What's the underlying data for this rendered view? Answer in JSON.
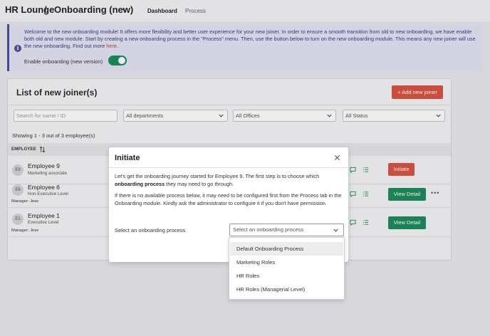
{
  "header": {
    "root": "HR Lounge",
    "separator": "/",
    "current": "Onboarding (new)",
    "tabs": [
      "Dashboard",
      "Process"
    ]
  },
  "banner": {
    "text": "Welcome to the new onboarding module! It offers more flexibility and better user experience for your new joiner. In order to ensure a smooth transition from old to new onboarding, we have enable both old and new module. Start by creating a new onboarding process in the \"Process\" menu. Then, use the button below to turn on the new onboarding module. This means any new joiner will use the new onboarding. Find out more ",
    "link": "here",
    "link_suffix": ".",
    "toggle_label": "Enable onboarding (new version)",
    "toggle_on": true
  },
  "card": {
    "title": "List of new joiner(s)",
    "add_button": "+ Add new joiner",
    "filters": {
      "search_placeholder": "Search for name / ID",
      "department": "All departments",
      "office": "All Offices",
      "status": "All Status"
    },
    "showing": "Showing 1 - 3 out of 3 employee(s)",
    "column_employee": "EMPLOYEE",
    "rows": [
      {
        "initials": "E9",
        "name": "Employee 9",
        "role": "Marketing associate",
        "manager": "",
        "action": "Initiate"
      },
      {
        "initials": "E6",
        "name": "Employee 6",
        "role": "Non-Executive Level",
        "manager": "Manager: Jess",
        "action": "View Detail"
      },
      {
        "initials": "E1",
        "name": "Employee 1",
        "role": "Executive Level",
        "manager": "Manager: Jess",
        "action": "View Detail"
      }
    ],
    "more": "•••"
  },
  "modal": {
    "title": "Initiate",
    "p1_before": "Let's get the onboarding journey started for Employee 9. The first step is to choose which ",
    "p1_bold": "onboarding process",
    "p1_after": " they may need to go through.",
    "p2": "If there is no available process below, it may need to be configured first from the Process tab in the Onboarding module. Kindly ask the administrator to configure it if you don't have permission.",
    "select_label": "Select an onboarding process",
    "select_placeholder": "Select an onboarding process",
    "options": [
      "Default Onboarding Process",
      "Marketing Roles",
      "HR Roles",
      "HR Roles (Managerial Level)"
    ],
    "highlighted_option": 0
  },
  "colors": {
    "primary_red": "#d9533f",
    "primary_green": "#1c8a5c",
    "banner_accent": "#4a4ea0"
  }
}
